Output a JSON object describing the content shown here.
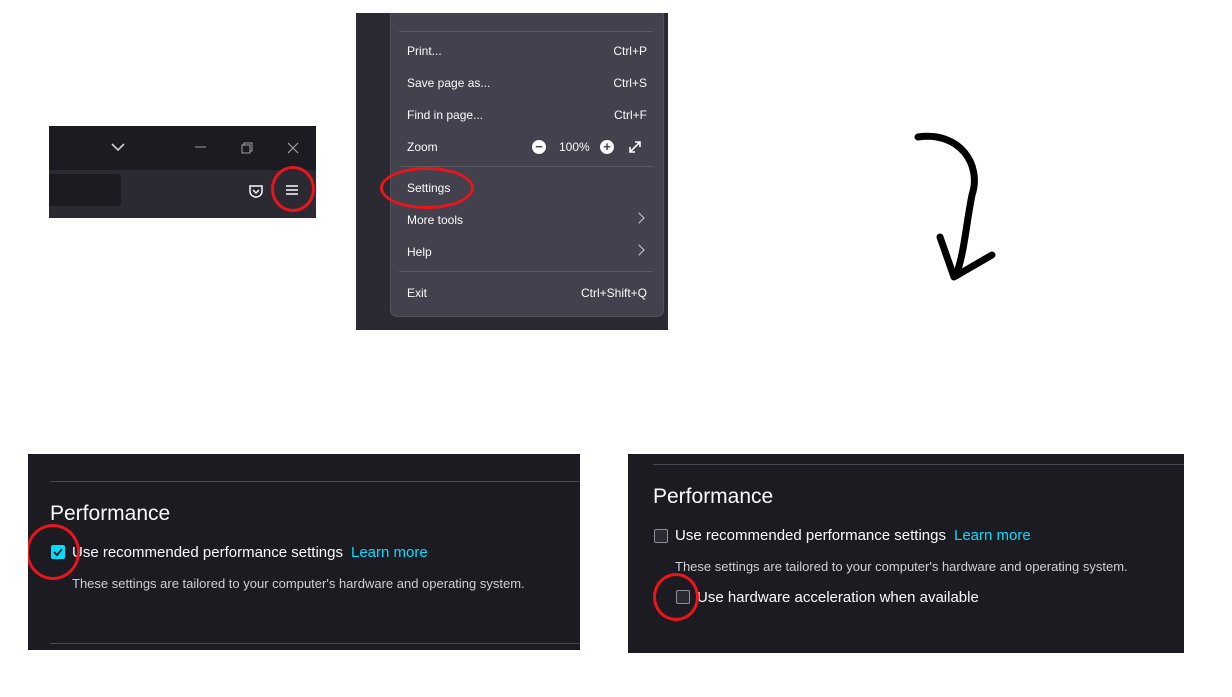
{
  "toolbar": {
    "icons": [
      "chevron-down-icon",
      "minimize-icon",
      "restore-icon",
      "close-icon",
      "pocket-icon",
      "hamburger-menu-icon"
    ]
  },
  "menu": {
    "items": [
      {
        "label": "Print...",
        "shortcut": "Ctrl+P"
      },
      {
        "label": "Save page as...",
        "shortcut": "Ctrl+S"
      },
      {
        "label": "Find in page...",
        "shortcut": "Ctrl+F"
      },
      {
        "label": "Zoom",
        "shortcut": ""
      },
      {
        "label": "Settings",
        "shortcut": ""
      },
      {
        "label": "More tools",
        "shortcut": ""
      },
      {
        "label": "Help",
        "shortcut": ""
      },
      {
        "label": "Exit",
        "shortcut": "Ctrl+Shift+Q"
      }
    ],
    "zoom_level": "100%",
    "zoom_minus": "−",
    "zoom_plus": "+"
  },
  "settings_before": {
    "title": "Performance",
    "recommended_label": "Use recommended performance settings",
    "recommended_checked": true,
    "learn_more": "Learn more",
    "description": "These settings are tailored to your computer's hardware and operating system."
  },
  "settings_after": {
    "title": "Performance",
    "recommended_label": "Use recommended performance settings",
    "recommended_checked": false,
    "learn_more": "Learn more",
    "description": "These settings are tailored to your computer's hardware and operating system.",
    "hw_accel_label": "Use hardware acceleration when available",
    "hw_accel_checked": false
  },
  "colors": {
    "highlight_ring": "#e8161b",
    "accent": "#00ddff",
    "menu_bg": "#42414d",
    "settings_bg": "#1c1b22"
  }
}
